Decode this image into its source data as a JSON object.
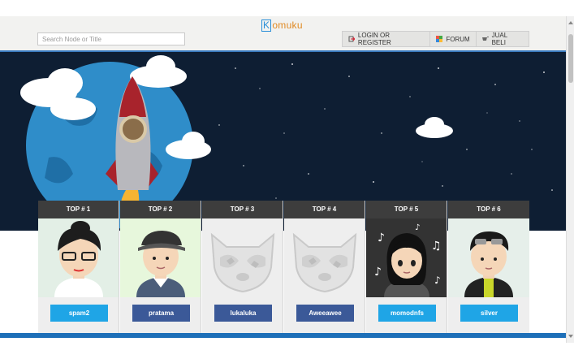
{
  "search": {
    "placeholder": "Search Node or Title"
  },
  "logo": {
    "first": "K",
    "rest": "omuku"
  },
  "nav": [
    {
      "label": "LOGIN OR REGISTER",
      "icon": "login-icon"
    },
    {
      "label": "FORUM",
      "icon": "forum-icon"
    },
    {
      "label": "JUAL BELI",
      "icon": "jual-beli-icon"
    }
  ],
  "leaderboard": [
    {
      "rank": "TOP # 1",
      "user": "spam2",
      "avatar": "avatar-glasses-woman",
      "bg": "#e3efe6",
      "btn": "#1fa5e6"
    },
    {
      "rank": "TOP # 2",
      "user": "pratama",
      "avatar": "avatar-cap-man",
      "bg": "#e7f7dc",
      "btn": "#3b5998"
    },
    {
      "rank": "TOP # 3",
      "user": "lukaluka",
      "avatar": "placeholder-raccoon",
      "bg": "#eeeeee",
      "btn": "#3b5998"
    },
    {
      "rank": "TOP # 4",
      "user": "Aweeawee",
      "avatar": "placeholder-raccoon",
      "bg": "#eeeeee",
      "btn": "#3b5998"
    },
    {
      "rank": "TOP # 5",
      "user": "momodnfs",
      "avatar": "avatar-music-girl",
      "bg": "#333333",
      "btn": "#1fa5e6"
    },
    {
      "rank": "TOP # 6",
      "user": "silver",
      "avatar": "avatar-sunglasses-man",
      "bg": "#e6efea",
      "btn": "#1fa5e6"
    }
  ],
  "colors": {
    "accent": "#3a7bbf",
    "hero": "#0e1e33",
    "footer_bar": "#1d6fb8"
  }
}
